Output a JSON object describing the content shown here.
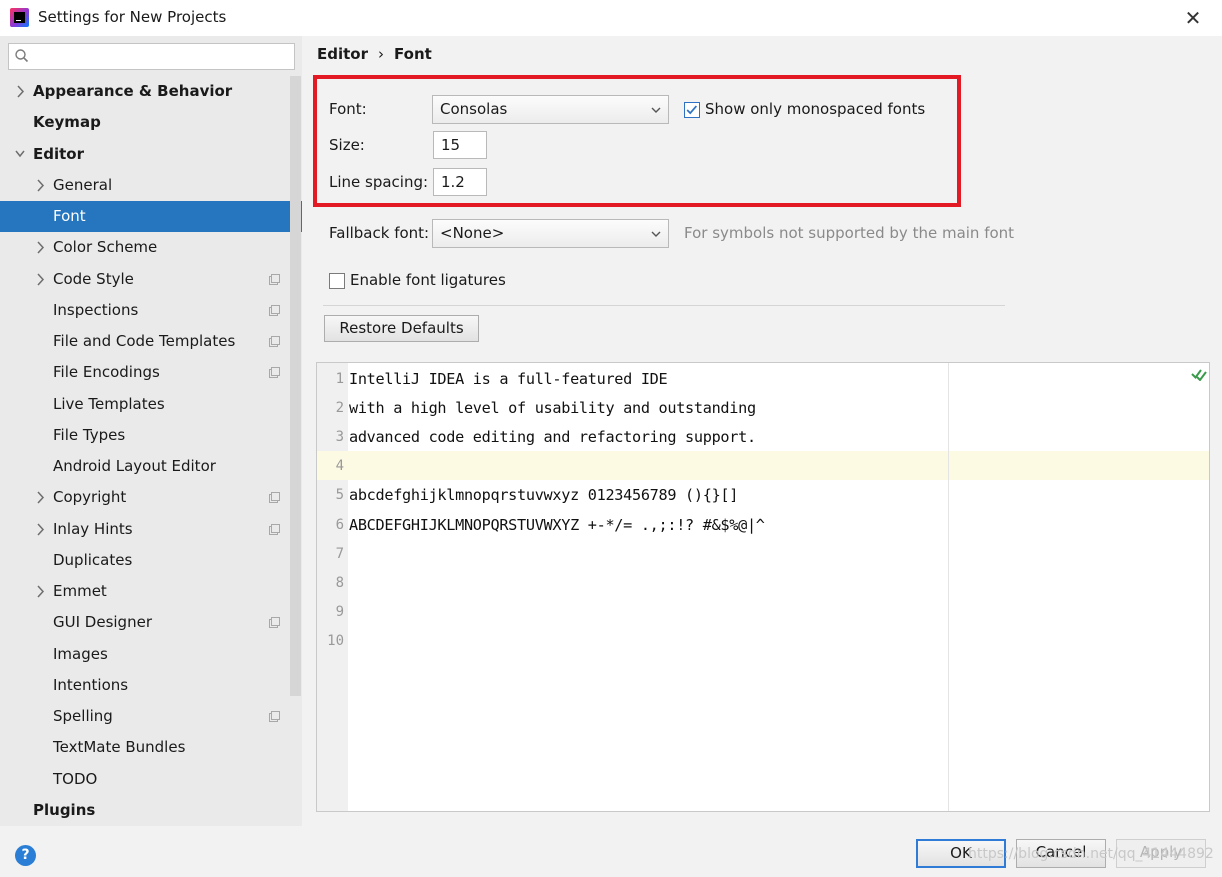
{
  "window": {
    "title": "Settings for New Projects",
    "close_glyph": "✕"
  },
  "search": {
    "value": "",
    "placeholder": ""
  },
  "sidebar": {
    "items": [
      {
        "label": "Appearance & Behavior",
        "level": 0,
        "expandable": true,
        "expanded": false,
        "bold": true,
        "project_icon": false,
        "selected": false
      },
      {
        "label": "Keymap",
        "level": 0,
        "expandable": false,
        "bold": true,
        "project_icon": false,
        "selected": false
      },
      {
        "label": "Editor",
        "level": 0,
        "expandable": true,
        "expanded": true,
        "bold": true,
        "project_icon": false,
        "selected": false
      },
      {
        "label": "General",
        "level": 1,
        "expandable": true,
        "expanded": false,
        "bold": false,
        "project_icon": false,
        "selected": false
      },
      {
        "label": "Font",
        "level": 1,
        "expandable": false,
        "bold": false,
        "project_icon": false,
        "selected": true
      },
      {
        "label": "Color Scheme",
        "level": 1,
        "expandable": true,
        "expanded": false,
        "bold": false,
        "project_icon": false,
        "selected": false
      },
      {
        "label": "Code Style",
        "level": 1,
        "expandable": true,
        "expanded": false,
        "bold": false,
        "project_icon": true,
        "selected": false
      },
      {
        "label": "Inspections",
        "level": 1,
        "expandable": false,
        "bold": false,
        "project_icon": true,
        "selected": false
      },
      {
        "label": "File and Code Templates",
        "level": 1,
        "expandable": false,
        "bold": false,
        "project_icon": true,
        "selected": false
      },
      {
        "label": "File Encodings",
        "level": 1,
        "expandable": false,
        "bold": false,
        "project_icon": true,
        "selected": false
      },
      {
        "label": "Live Templates",
        "level": 1,
        "expandable": false,
        "bold": false,
        "project_icon": false,
        "selected": false
      },
      {
        "label": "File Types",
        "level": 1,
        "expandable": false,
        "bold": false,
        "project_icon": false,
        "selected": false
      },
      {
        "label": "Android Layout Editor",
        "level": 1,
        "expandable": false,
        "bold": false,
        "project_icon": false,
        "selected": false
      },
      {
        "label": "Copyright",
        "level": 1,
        "expandable": true,
        "expanded": false,
        "bold": false,
        "project_icon": true,
        "selected": false
      },
      {
        "label": "Inlay Hints",
        "level": 1,
        "expandable": true,
        "expanded": false,
        "bold": false,
        "project_icon": true,
        "selected": false
      },
      {
        "label": "Duplicates",
        "level": 1,
        "expandable": false,
        "bold": false,
        "project_icon": false,
        "selected": false
      },
      {
        "label": "Emmet",
        "level": 1,
        "expandable": true,
        "expanded": false,
        "bold": false,
        "project_icon": false,
        "selected": false
      },
      {
        "label": "GUI Designer",
        "level": 1,
        "expandable": false,
        "bold": false,
        "project_icon": true,
        "selected": false
      },
      {
        "label": "Images",
        "level": 1,
        "expandable": false,
        "bold": false,
        "project_icon": false,
        "selected": false
      },
      {
        "label": "Intentions",
        "level": 1,
        "expandable": false,
        "bold": false,
        "project_icon": false,
        "selected": false
      },
      {
        "label": "Spelling",
        "level": 1,
        "expandable": false,
        "bold": false,
        "project_icon": true,
        "selected": false
      },
      {
        "label": "TextMate Bundles",
        "level": 1,
        "expandable": false,
        "bold": false,
        "project_icon": false,
        "selected": false
      },
      {
        "label": "TODO",
        "level": 1,
        "expandable": false,
        "bold": false,
        "project_icon": false,
        "selected": false
      },
      {
        "label": "Plugins",
        "level": 0,
        "expandable": false,
        "bold": true,
        "project_icon": false,
        "selected": false
      }
    ]
  },
  "breadcrumb": {
    "parent": "Editor",
    "separator": "›",
    "current": "Font"
  },
  "font_settings": {
    "font_label": "Font:",
    "font_value": "Consolas",
    "monospaced_label": "Show only monospaced fonts",
    "monospaced_checked": true,
    "size_label": "Size:",
    "size_value": "15",
    "line_spacing_label": "Line spacing:",
    "line_spacing_value": "1.2",
    "fallback_label": "Fallback font:",
    "fallback_value": "<None>",
    "fallback_hint": "For symbols not supported by the main font",
    "ligatures_label": "Enable font ligatures",
    "ligatures_checked": false,
    "restore_label": "Restore Defaults"
  },
  "preview": {
    "lines": [
      "IntelliJ IDEA is a full-featured IDE",
      "with a high level of usability and outstanding",
      "advanced code editing and refactoring support.",
      "",
      "abcdefghijklmnopqrstuvwxyz 0123456789 (){}[]",
      "ABCDEFGHIJKLMNOPQRSTUVWXYZ +-*/= .,;:!? #&$%@|^",
      "",
      "",
      "",
      ""
    ],
    "line_numbers": [
      "1",
      "2",
      "3",
      "4",
      "5",
      "6",
      "7",
      "8",
      "9",
      "10"
    ],
    "current_line": 4
  },
  "footer": {
    "ok_label": "OK",
    "cancel_label": "Cancel",
    "apply_label": "Apply",
    "help_glyph": "?",
    "watermark": "https://blog.csdn.net/qq_41444892"
  },
  "colors": {
    "selection": "#2675bf",
    "highlight_border": "#e31a23",
    "current_line": "#fdfae4",
    "accent": "#2f7bd6"
  },
  "icons": [
    "app-logo-icon",
    "search-icon",
    "close-icon",
    "chevron-right-icon",
    "chevron-down-icon",
    "project-settings-icon",
    "dropdown-arrow-icon",
    "checkmark-icon",
    "help-icon",
    "inspection-ok-icon"
  ]
}
